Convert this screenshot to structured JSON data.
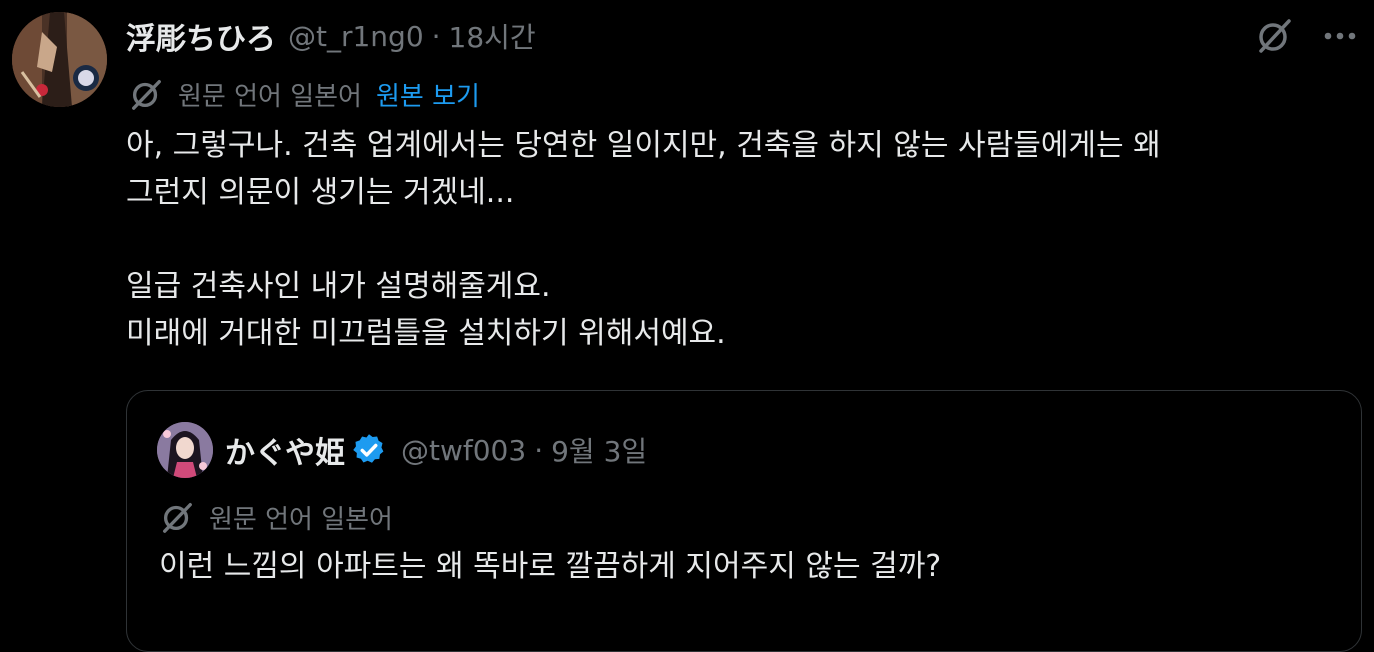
{
  "tweet": {
    "author": {
      "display_name": "浮彫ちひろ",
      "handle": "@t_r1ng0",
      "separator": "·",
      "time": "18시간"
    },
    "translation": {
      "label": "원문 언어 일본어",
      "show_original": "원본 보기"
    },
    "text_lines": [
      "아, 그렇구나. 건축 업계에서는 당연한 일이지만, 건축을 하지 않는 사람들에게는 왜",
      "그런지 의문이 생기는 거겠네...",
      "",
      "일급 건축사인 내가 설명해줄게요.",
      "미래에 거대한 미끄럼틀을 설치하기 위해서예요."
    ],
    "more_icon": "more-horizontal-icon",
    "grok_icon": "grok-slash-icon"
  },
  "quote": {
    "author": {
      "display_name": "かぐや姫",
      "handle": "@twf003",
      "separator": "·",
      "time": "9월 3일",
      "verified": true
    },
    "translation": {
      "label": "원문 언어 일본어"
    },
    "text": "이런 느낌의 아파트는 왜 똑바로 깔끔하게 지어주지 않는 걸까?"
  },
  "colors": {
    "background": "#000000",
    "text_primary": "#e7e9ea",
    "text_secondary": "#71767b",
    "link": "#1d9bf0",
    "border": "#2f3336",
    "verified": "#1d9bf0"
  }
}
